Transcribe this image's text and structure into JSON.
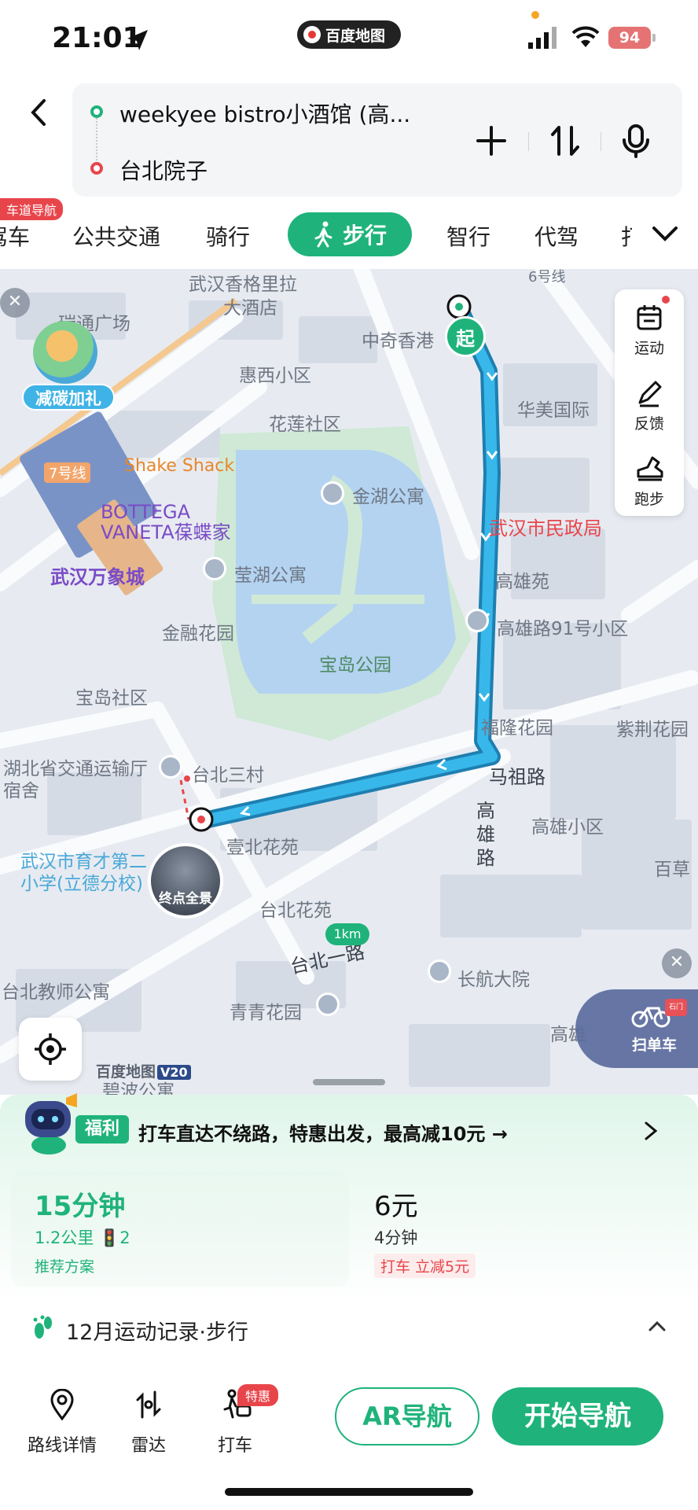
{
  "status_bar": {
    "time": "21:01",
    "app": "百度地图",
    "battery": "94"
  },
  "route": {
    "start": "weekyee bistro小酒馆 (高...",
    "end": "台北院子"
  },
  "modes": {
    "badge": "车道导航",
    "items": [
      "驾车",
      "公共交通",
      "骑行",
      "步行",
      "智行",
      "代驾",
      "打车"
    ],
    "active": "步行"
  },
  "map": {
    "promo_badge": "减碳加礼",
    "side_tools": [
      "运动",
      "反馈",
      "跑步"
    ],
    "start_marker": "起",
    "end_thumb": "终点全景",
    "scale": "1km",
    "logo": "百度地图",
    "logo_version": "V20",
    "bike_button": "扫单车",
    "bike_tag": "石门",
    "labels": {
      "wuhan_shangri": "武汉香格里拉",
      "hotel": "大酒店",
      "ruitong": "瑞通广场",
      "zhongqi": "中奇香港",
      "huixi": "惠西小区",
      "huamei": "华美国际",
      "hualian": "花莲社区",
      "line7": "7号线",
      "line6": "6号线",
      "shake": "Shake Shack",
      "jinhu": "金湖公寓",
      "minzheng": "武汉市民政局",
      "bottega": "BOTTEGA VANETA葆蝶家",
      "mixc": "武汉万象城",
      "yinghu": "莹湖公寓",
      "gaoxiong_yuan": "高雄苑",
      "jinrong": "金融花园",
      "baodao_park": "宝岛公园",
      "gx91": "高雄路91号小区",
      "baodao_sq": "宝岛社区",
      "fulong": "福隆花园",
      "zijing": "紫荆花园",
      "hubei": "湖北省交通运输厅宿舍",
      "taibei3": "台北三村",
      "mazu": "马祖路",
      "gaoxiong_road": "高雄路",
      "gaoxiong_xq": "高雄小区",
      "yucai": "武汉市育才第二小学(立德分校)",
      "yibei": "壹北花苑",
      "baicao": "百草",
      "taibei_huayuan": "台北花苑",
      "taibei_road": "台北一路",
      "changhang": "长航大院",
      "taibei_teacher": "台北教师公寓",
      "qingqing": "青青花园",
      "bibo": "碧波公寓",
      "gao": "高雄"
    }
  },
  "sheet": {
    "fuli": "福利",
    "promo": "打车直达不绕路，特惠出发，最高减10元 →",
    "plan1": {
      "time": "15分钟",
      "detail": "1.2公里  🚦2",
      "tag": "推荐方案"
    },
    "plan2": {
      "price": "6元",
      "detail": "4分钟",
      "tag": "打车  立减5元"
    },
    "record": "12月运动记录·步行"
  },
  "bottom": {
    "items": [
      "路线详情",
      "雷达",
      "打车"
    ],
    "badge": "特惠",
    "ar": "AR导航",
    "start": "开始导航"
  },
  "colors": {
    "accent": "#1fb37b",
    "route": "#2aa9e0",
    "danger": "#e8454b"
  }
}
